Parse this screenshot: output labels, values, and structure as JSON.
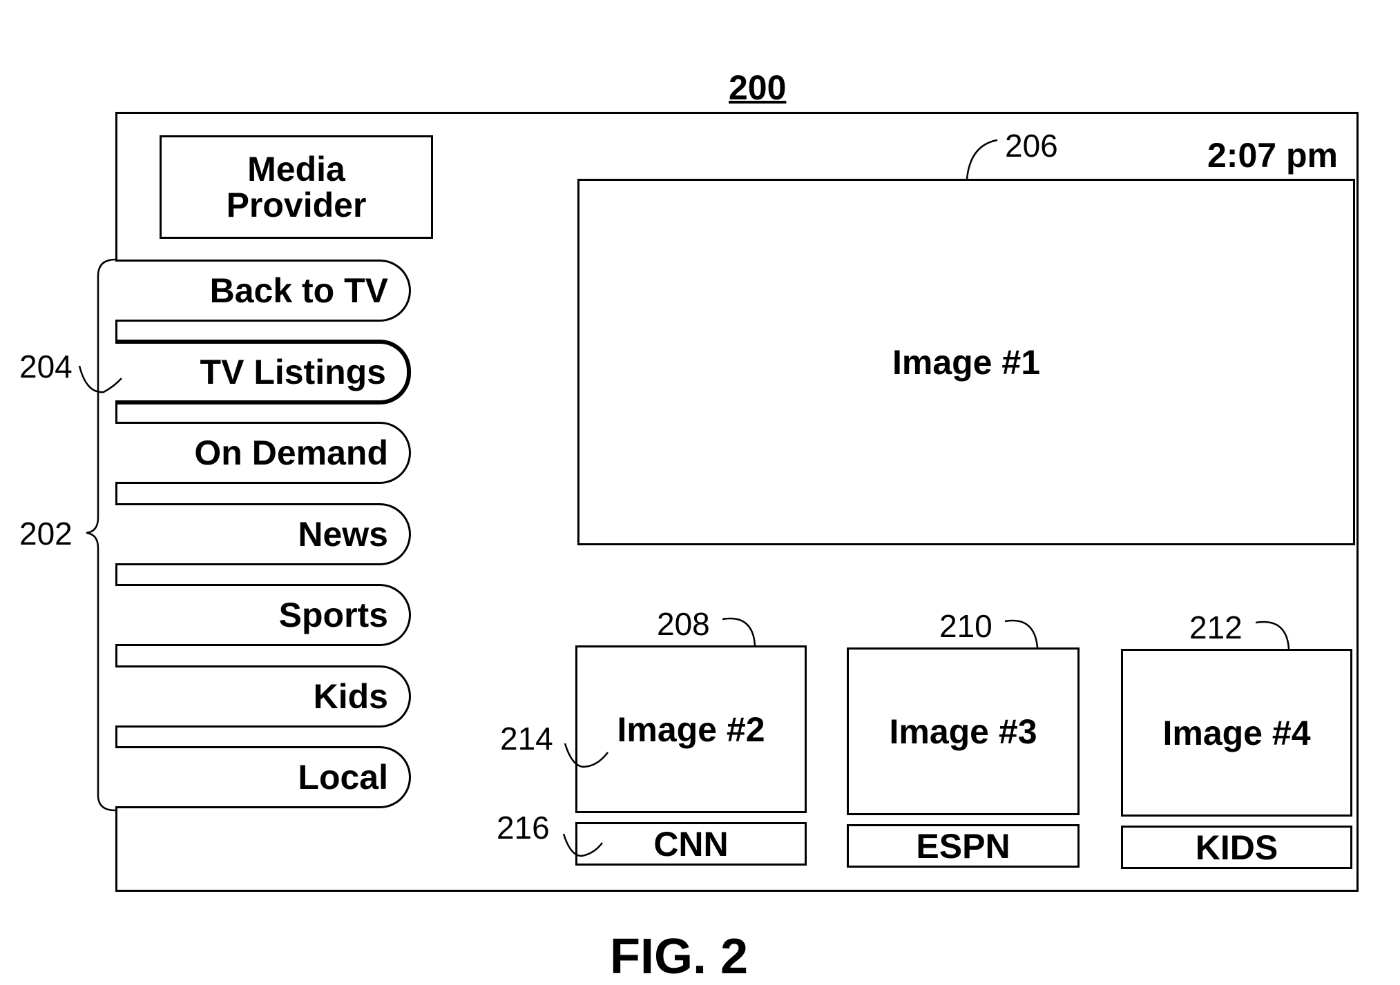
{
  "figure": {
    "number_label": "200",
    "caption": "FIG. 2"
  },
  "screen": {
    "brand": {
      "line1": "Media",
      "line2": "Provider"
    },
    "clock": "2:07 pm",
    "menu": {
      "items": [
        {
          "label": "Back to TV",
          "selected": false
        },
        {
          "label": "TV Listings",
          "selected": true
        },
        {
          "label": "On Demand",
          "selected": false
        },
        {
          "label": "News",
          "selected": false
        },
        {
          "label": "Sports",
          "selected": false
        },
        {
          "label": "Kids",
          "selected": false
        },
        {
          "label": "Local",
          "selected": false
        }
      ]
    },
    "main_image": {
      "label": "Image #1"
    },
    "thumbnails": [
      {
        "label": "Image #2",
        "channel": "CNN"
      },
      {
        "label": "Image #3",
        "channel": "ESPN"
      },
      {
        "label": "Image #4",
        "channel": "KIDS"
      }
    ]
  },
  "reference_numerals": {
    "menu_group": "202",
    "selected_item": "204",
    "main_image": "206",
    "thumb_1": "208",
    "thumb_2": "210",
    "thumb_3": "212",
    "thumb_image": "214",
    "thumb_channel_label": "216"
  }
}
